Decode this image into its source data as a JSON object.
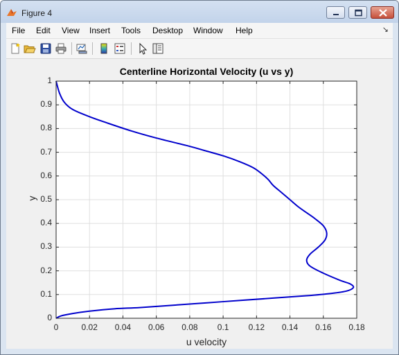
{
  "window": {
    "title": "Figure 4",
    "app_icon": "matlab-icon",
    "controls": [
      "minimize-icon",
      "maximize-icon",
      "close-icon"
    ]
  },
  "menu": {
    "items": [
      "File",
      "Edit",
      "View",
      "Insert",
      "Tools",
      "Desktop",
      "Window",
      "Help"
    ],
    "overflow_icon": "dock-arrow-icon"
  },
  "toolbar": {
    "buttons": [
      "new-figure-icon",
      "open-icon",
      "save-icon",
      "print-icon",
      "link-plot-icon",
      "colorbar-icon",
      "legend-icon",
      "pointer-icon",
      "property-editor-icon"
    ]
  },
  "colors": {
    "line": "#0000cc",
    "axes_bg": "#ffffff",
    "figure_bg": "#f0f0f0",
    "grid": "#dfdfdf"
  },
  "chart_data": {
    "type": "line",
    "title": "Centerline Horizontal Velocity (u vs y)",
    "xlabel": "u velocity",
    "ylabel": "y",
    "xlim": [
      0,
      0.18
    ],
    "ylim": [
      0,
      1
    ],
    "xticks": [
      "0",
      "0.02",
      "0.04",
      "0.06",
      "0.08",
      "0.1",
      "0.12",
      "0.14",
      "0.16",
      "0.18"
    ],
    "yticks": [
      "0",
      "0.1",
      "0.2",
      "0.3",
      "0.4",
      "0.5",
      "0.6",
      "0.7",
      "0.8",
      "0.9",
      "1"
    ],
    "grid": true,
    "series": [
      {
        "x": [
          0,
          0.003,
          0.01,
          0.02,
          0.035,
          0.05,
          0.07,
          0.1,
          0.13,
          0.15,
          0.165,
          0.174,
          0.178,
          0.176,
          0.17,
          0.16,
          0.152,
          0.15,
          0.152,
          0.157,
          0.161,
          0.162,
          0.16,
          0.155,
          0.15,
          0.145,
          0.14,
          0.135,
          0.13,
          0.127,
          0.123,
          0.118,
          0.11,
          0.1,
          0.09,
          0.08,
          0.06,
          0.045,
          0.03,
          0.02,
          0.01,
          0.005,
          0.002,
          0
        ],
        "y": [
          0,
          0.01,
          0.02,
          0.03,
          0.04,
          0.045,
          0.055,
          0.07,
          0.085,
          0.095,
          0.105,
          0.115,
          0.13,
          0.145,
          0.16,
          0.19,
          0.22,
          0.245,
          0.27,
          0.3,
          0.33,
          0.36,
          0.39,
          0.42,
          0.445,
          0.47,
          0.5,
          0.53,
          0.56,
          0.585,
          0.61,
          0.635,
          0.66,
          0.685,
          0.705,
          0.725,
          0.76,
          0.79,
          0.825,
          0.85,
          0.88,
          0.91,
          0.95,
          1.0
        ]
      }
    ]
  }
}
